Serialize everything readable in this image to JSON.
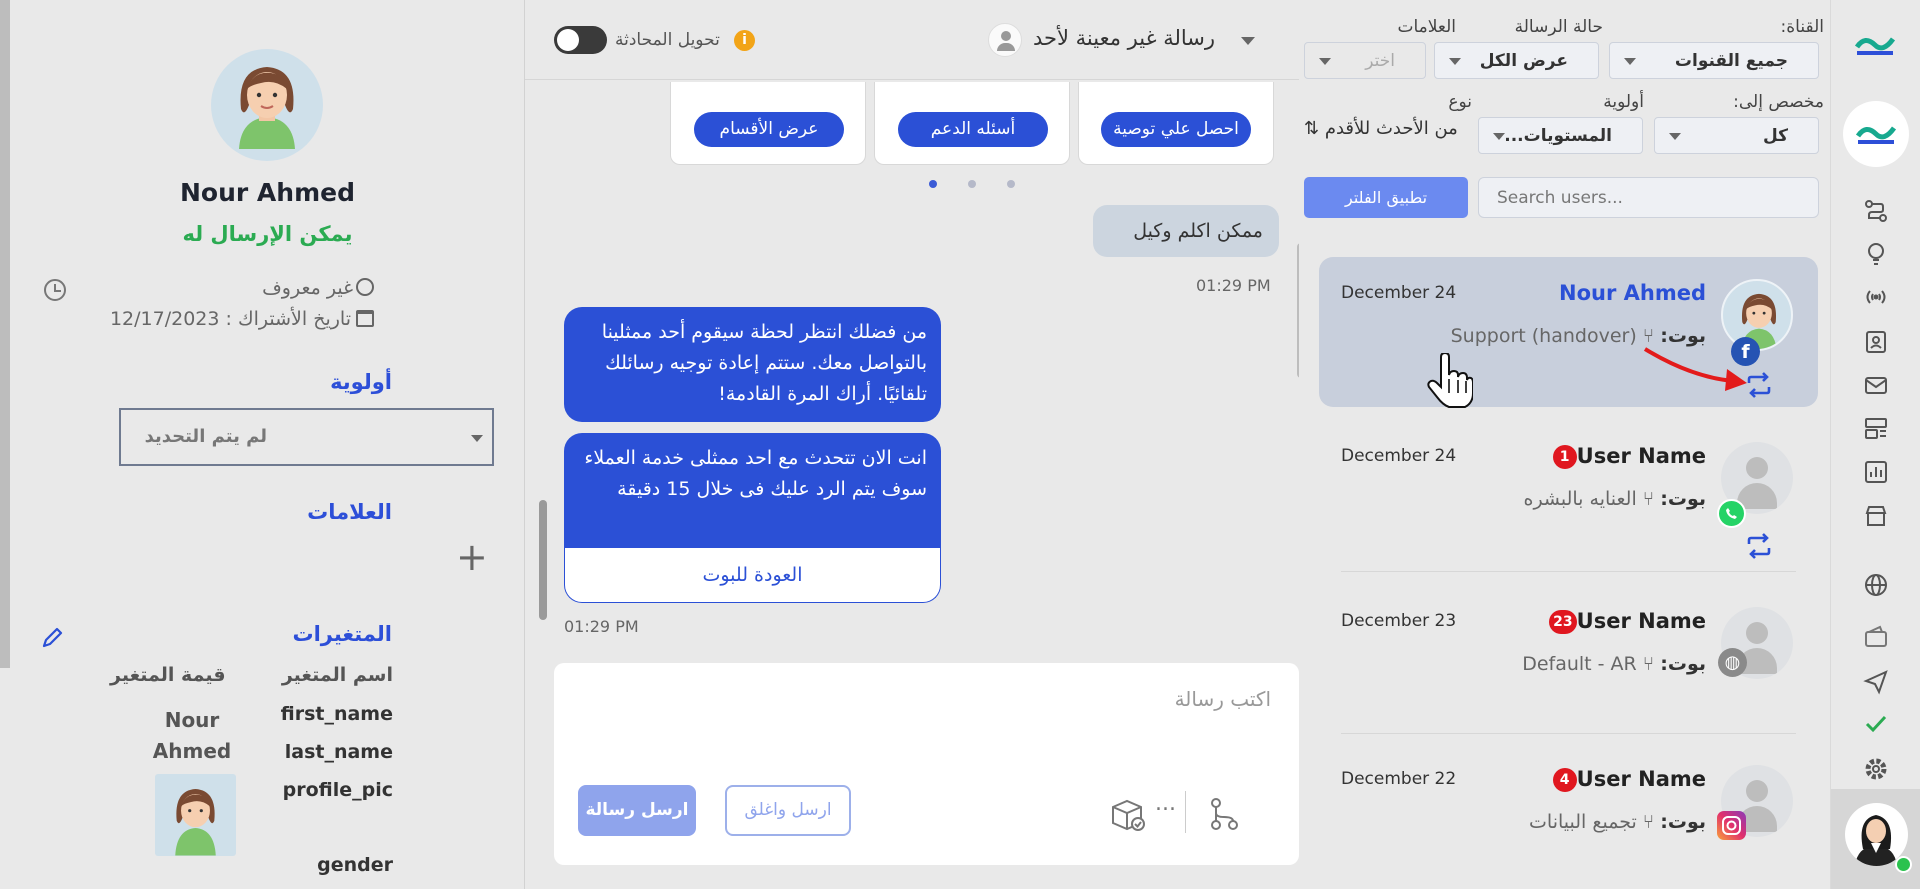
{
  "profile": {
    "name": "Nour Ahmed",
    "status": "يمكن الإرسال له",
    "location": "غير معروف",
    "subscribed": "تاريخ الأشتراك : 12/17/2023",
    "priority_title": "أولوية",
    "priority_value": "لم يتم التحديد",
    "tags_title": "العلامات",
    "variables_title": "المتغيرات",
    "var_name_header": "اسم المتغير",
    "var_value_header": "قيمة المتغير",
    "variables": [
      {
        "name": "first_name",
        "value": "Nour"
      },
      {
        "name": "last_name",
        "value": "Ahmed"
      },
      {
        "name": "profile_pic",
        "value": ""
      },
      {
        "name": "gender",
        "value": ""
      }
    ]
  },
  "chat": {
    "transfer_label": "تحويل المحادثة",
    "assign_label": "رسالة غير معينة لأحد",
    "quick_replies": [
      "احصل علي توصية",
      "أسئله الدعم",
      "عرض الأقسام"
    ],
    "msg_in": "ممكن اكلم وكيل",
    "msg_in_time": "01:29 PM",
    "msg_out_1": "من فضلك انتظر لحظة سيقوم أحد ممثلينا بالتواصل معك. ستتم إعادة توجيه رسائلك تلقائيًا. أراك المرة القادمة!",
    "msg_out_2": "انت الان تتحدث مع احد ممثلى خدمة العملاء سوف يتم الرد عليك فى خلال 15 دقيقة",
    "back_to_bot": "العودة للبوت",
    "msg_out_time": "01:29 PM",
    "composer_placeholder": "اكتب رسالة",
    "send_label": "ارسل رسالة",
    "send_close_label": "ارسل واغلق",
    "more": "..."
  },
  "filters": {
    "channel_label": "القناة:",
    "channel_value": "جميع القنوات",
    "msg_status_label": "حالة الرسالة",
    "msg_status_value": "عرض الكل",
    "tags_label": "العلامات",
    "tags_placeholder": "اختر",
    "assigned_label": "مخصص إلى:",
    "assigned_value": "كل",
    "priority_label": "أولوية",
    "priority_value": "...المستويات",
    "type_label": "نوع",
    "sort_label": "من الأحدث للأقدم",
    "search_placeholder": "Search users...",
    "apply_label": "تطبيق الفلتر"
  },
  "conversations": [
    {
      "name": "Nour Ahmed",
      "date": "December 24",
      "bot_prefix": "بوت:",
      "bot": "Support (handover)",
      "unread": "",
      "channel": "facebook",
      "selected": true
    },
    {
      "name": "User Name",
      "date": "December 24",
      "bot_prefix": "بوت:",
      "bot": "العنايه بالبشره",
      "unread": "1",
      "channel": "whatsapp",
      "selected": false
    },
    {
      "name": "User Name",
      "date": "December 23",
      "bot_prefix": "بوت:",
      "bot": "Default - AR",
      "unread": "23",
      "channel": "web",
      "selected": false
    },
    {
      "name": "User Name",
      "date": "December 22",
      "bot_prefix": "بوت:",
      "bot": "تجميع البيانات",
      "unread": "4",
      "channel": "instagram",
      "selected": false
    }
  ],
  "colors": {
    "primary": "#2b50d6",
    "success": "#2bab52",
    "unread": "#e0171f",
    "brand": "#17a98f"
  }
}
